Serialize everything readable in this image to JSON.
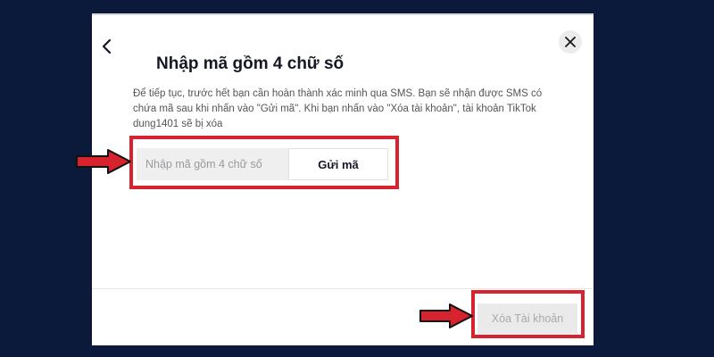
{
  "dialog": {
    "title": "Nhập mã gồm 4 chữ số",
    "description": "Để tiếp tục, trước hết bạn cần hoàn thành xác minh qua SMS. Bạn sẽ nhận được SMS có chứa mã sau khi nhấn vào \"Gửi mã\". Khi bạn nhấn vào \"Xóa tài khoản\", tài khoản TikTok dung1401 sẽ bị xóa",
    "code_input": {
      "placeholder": "Nhập mã gồm 4 chữ số",
      "value": ""
    },
    "send_code_label": "Gửi mã",
    "delete_account_label": "Xóa Tài khoản",
    "delete_account_enabled": false,
    "icons": {
      "back": "chevron-left-icon",
      "close": "close-icon"
    }
  },
  "annotations": {
    "highlight_color": "#d7232d",
    "pointer_icon": "arrow-right-icon"
  },
  "colors": {
    "backdrop": "#0b1a3a",
    "dialog_bg": "#ffffff",
    "text_primary": "#161823",
    "text_secondary": "#555555",
    "input_bg": "#efeff0",
    "disabled_bg": "#eaeaea",
    "disabled_text": "#a9a9ad"
  }
}
